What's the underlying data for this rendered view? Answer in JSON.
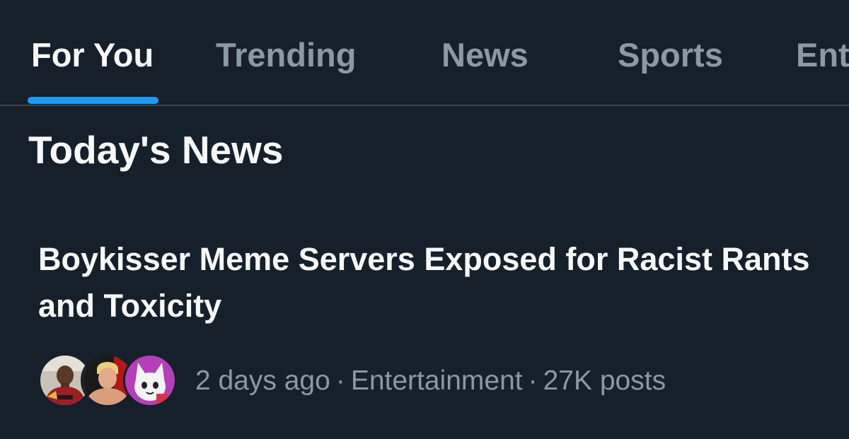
{
  "tabs": [
    {
      "label": "For You",
      "active": true
    },
    {
      "label": "Trending",
      "active": false
    },
    {
      "label": "News",
      "active": false
    },
    {
      "label": "Sports",
      "active": false
    },
    {
      "label": "Ent",
      "active": false
    }
  ],
  "section": {
    "title": "Today's News"
  },
  "story": {
    "headline": "Boykisser Meme Servers Exposed for Racist Rants and Toxicity",
    "time": "2 days ago",
    "category": "Entertainment",
    "posts": "27K posts",
    "separator": "·",
    "avatars": [
      "avatar-soccer-player",
      "avatar-blond-man",
      "avatar-cartoon-cat"
    ]
  },
  "colors": {
    "background": "#15202b",
    "accent": "#1d9bf0",
    "text_primary": "#f7f9f9",
    "text_secondary": "#8b98a5",
    "divider": "#38444d"
  }
}
